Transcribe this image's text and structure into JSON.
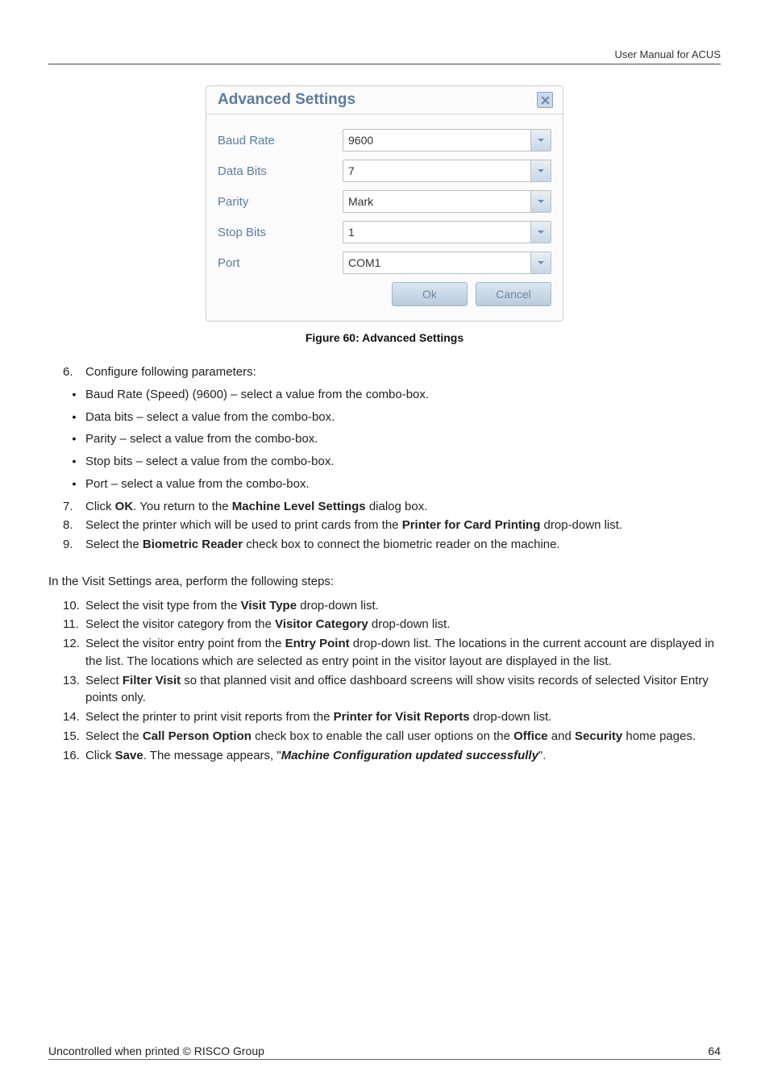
{
  "header": {
    "text": "User Manual for ACUS"
  },
  "dialog": {
    "title": "Advanced Settings",
    "fields": [
      {
        "label": "Baud Rate",
        "value": "9600"
      },
      {
        "label": "Data Bits",
        "value": "7"
      },
      {
        "label": "Parity",
        "value": "Mark"
      },
      {
        "label": "Stop Bits",
        "value": "1"
      },
      {
        "label": "Port",
        "value": "COM1"
      }
    ],
    "buttons": {
      "ok": "Ok",
      "cancel": "Cancel"
    }
  },
  "caption": "Figure 60: Advanced Settings",
  "list6": {
    "num": "6.",
    "text": "Configure following parameters:"
  },
  "bullets": [
    "Baud Rate (Speed) (9600) – select a value from the combo-box.",
    "Data bits – select a value from the combo-box.",
    "Parity – select a value from the combo-box.",
    "Stop bits – select a value from the combo-box.",
    "Port – select a value from the combo-box."
  ],
  "items789": {
    "7": {
      "num": "7.",
      "pre": "Click ",
      "b1": "OK",
      "mid": ". You return to the ",
      "b2": "Machine Level Settings",
      "post": " dialog box."
    },
    "8": {
      "num": "8.",
      "pre": "Select the printer which will be used to print cards from the ",
      "b1": "Printer for Card Printing",
      "post": " drop-down list."
    },
    "9": {
      "num": "9.",
      "pre": "Select the ",
      "b1": "Biometric Reader",
      "post": " check box to connect the biometric reader on the machine."
    }
  },
  "section2_intro": "In the Visit Settings area, perform the following steps:",
  "items10_16": {
    "10": {
      "num": "10.",
      "pre": "Select the visit type from the ",
      "b1": "Visit Type",
      "post": " drop-down list."
    },
    "11": {
      "num": "11.",
      "pre": "Select the visitor category from the ",
      "b1": "Visitor Category",
      "post": " drop-down list."
    },
    "12": {
      "num": "12.",
      "pre": "Select the visitor entry point from the ",
      "b1": "Entry Point",
      "post": " drop-down list. The locations in the current account are displayed in the list. The locations which are selected as entry point in the visitor layout are displayed in the list."
    },
    "13": {
      "num": "13.",
      "pre": "Select ",
      "b1": "Filter Visit",
      "post": " so that planned visit and office dashboard screens will show visits records of selected Visitor Entry points only."
    },
    "14": {
      "num": "14.",
      "pre": "Select the printer to print visit reports from the ",
      "b1": "Printer for Visit Reports",
      "post": " drop-down list."
    },
    "15": {
      "num": "15.",
      "pre": "Select the ",
      "b1": "Call Person Option",
      "mid": " check box to enable the call user options on the ",
      "b2": "Office",
      "mid2": " and ",
      "b3": "Security",
      "post": " home pages."
    },
    "16": {
      "num": "16.",
      "pre": "Click ",
      "b1": "Save",
      "mid": ". The message appears, \"",
      "bi": "Machine Configuration updated successfully",
      "post": "\"."
    }
  },
  "footer": {
    "left": "Uncontrolled when printed © RISCO Group",
    "right": "64"
  }
}
